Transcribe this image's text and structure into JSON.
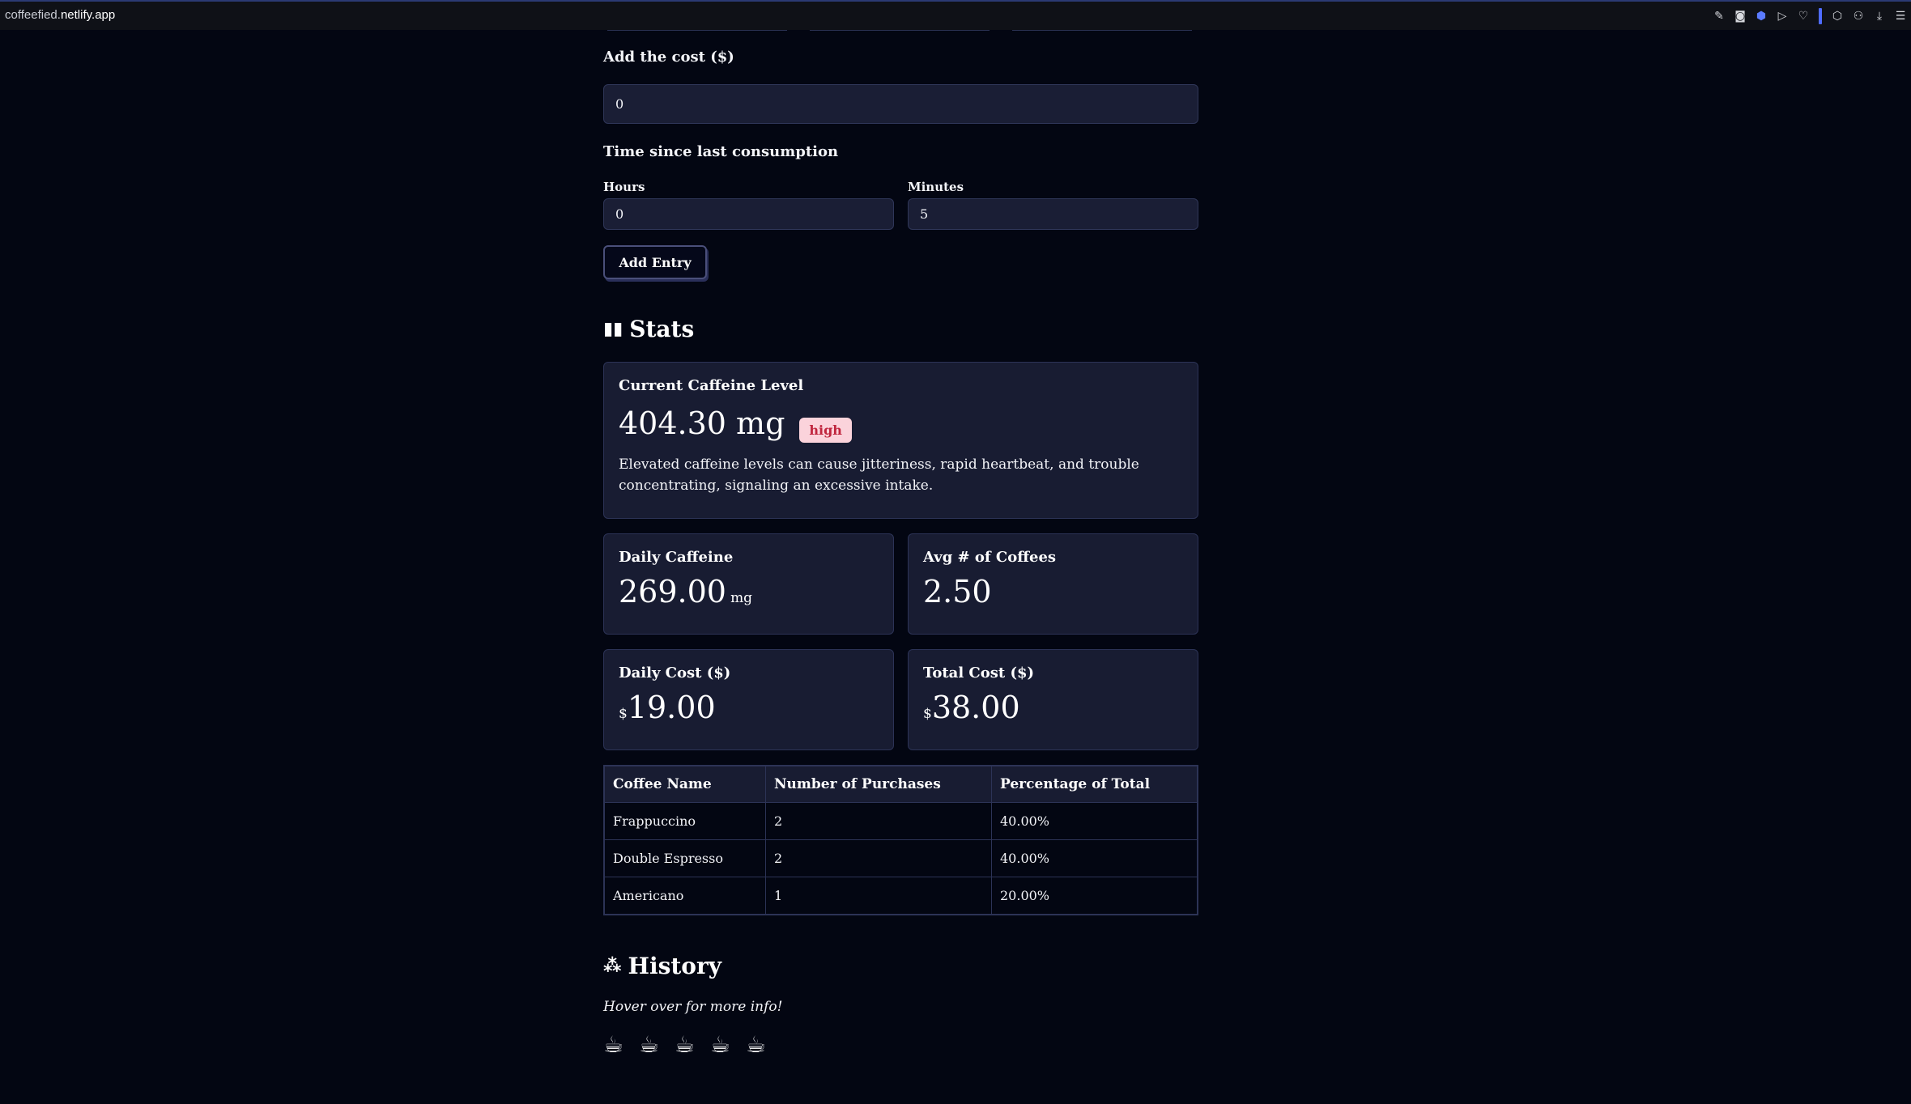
{
  "browser": {
    "url_prefix": "coffeefied.",
    "url_host": "netlify.app"
  },
  "form": {
    "cost_label": "Add the cost ($)",
    "cost_value": "0",
    "time_label": "Time since last consumption",
    "hours_label": "Hours",
    "hours_value": "0",
    "minutes_label": "Minutes",
    "minutes_value": "5",
    "add_button": "Add Entry"
  },
  "stats": {
    "title": "Stats",
    "current": {
      "title": "Current Caffeine Level",
      "value": "404.30 mg",
      "badge": "high",
      "description": "Elevated caffeine levels can cause jitteriness, rapid heartbeat, and trouble concentrating, signaling an excessive intake."
    },
    "daily_caffeine": {
      "title": "Daily Caffeine",
      "value": "269.00",
      "unit": "mg"
    },
    "avg_coffees": {
      "title": "Avg # of Coffees",
      "value": "2.50"
    },
    "daily_cost": {
      "title": "Daily Cost ($)",
      "currency": "$",
      "value": "19.00"
    },
    "total_cost": {
      "title": "Total Cost ($)",
      "currency": "$",
      "value": "38.00"
    },
    "table": {
      "headers": [
        "Coffee Name",
        "Number of Purchases",
        "Percentage of Total"
      ],
      "rows": [
        [
          "Frappuccino",
          "2",
          "40.00%"
        ],
        [
          "Double Espresso",
          "2",
          "40.00%"
        ],
        [
          "Americano",
          "1",
          "20.00%"
        ]
      ]
    }
  },
  "history": {
    "title": "History",
    "hint": "Hover over for more info!",
    "entries": [
      "coffee-cup-icon",
      "coffee-cup-icon",
      "coffee-cup-icon",
      "coffee-cup-icon",
      "coffee-cup-icon"
    ]
  },
  "colors": {
    "background": "#030612",
    "card": "#181c32",
    "badge_bg": "#fbd3db",
    "badge_text": "#c0263e"
  }
}
